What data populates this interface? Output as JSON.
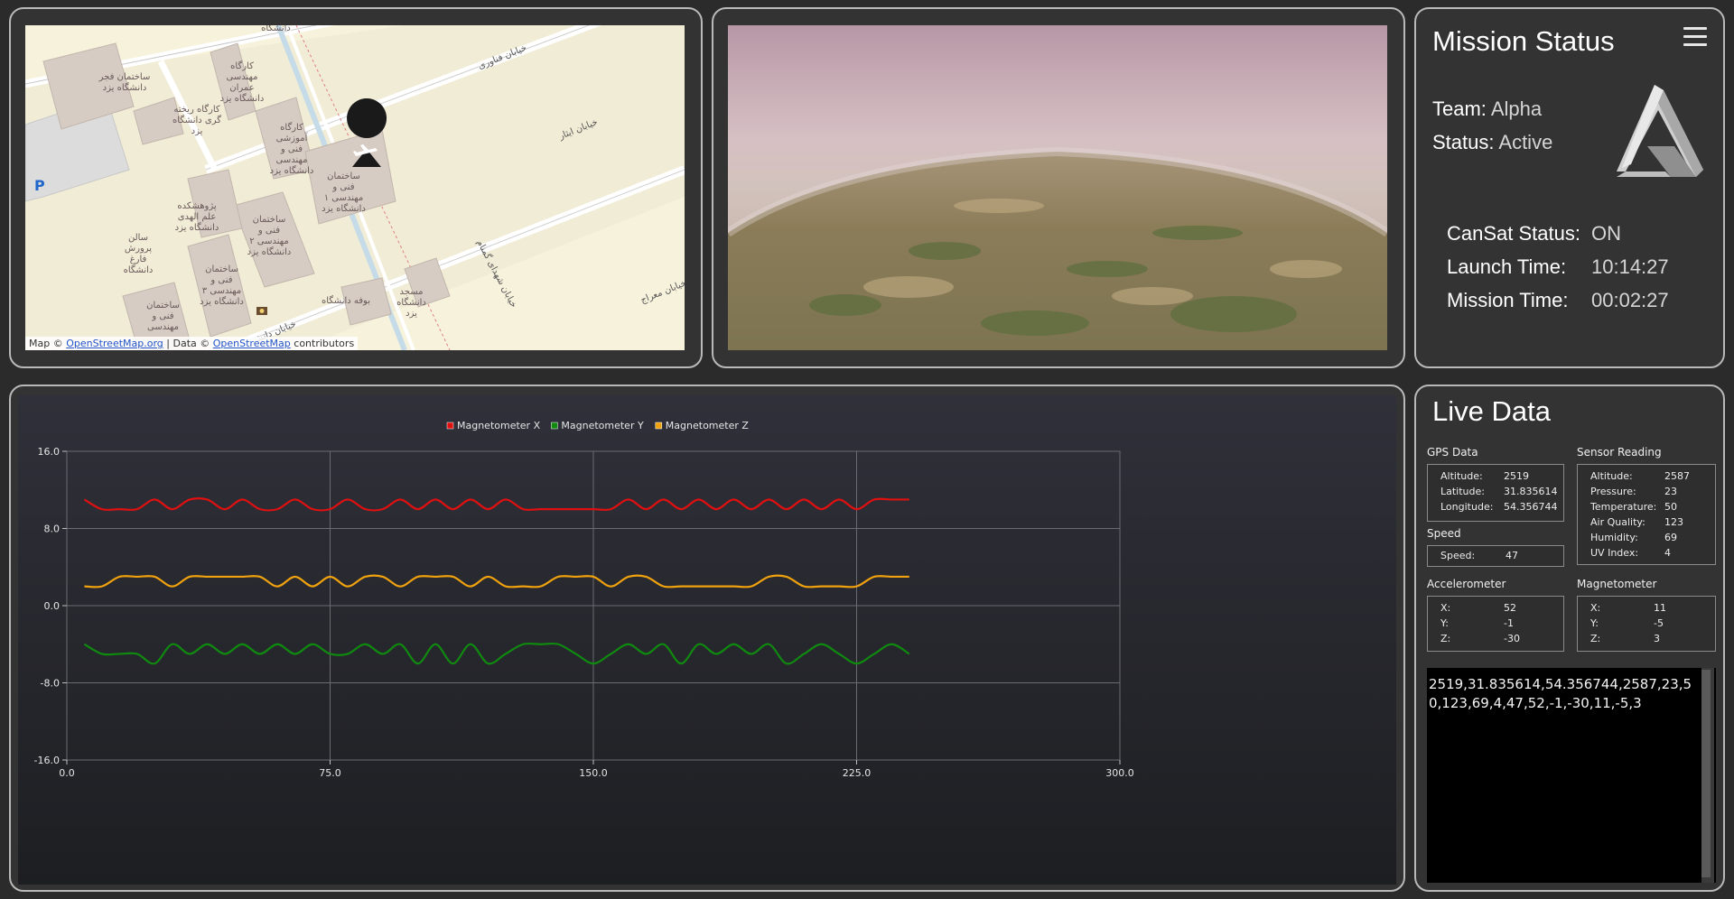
{
  "map": {
    "attribution_prefix": "Map © ",
    "attribution_link1": "OpenStreetMap.org",
    "attribution_mid": " | Data © ",
    "attribution_link2": "OpenStreetMap",
    "attribution_suffix": " contributors",
    "parking_label": "P",
    "buildings": [
      "ساختمان فجر دانشگاه یزد",
      "کارگاه مهندسی عمران دانشگاه یزد",
      "کارگاه ریخته گری دانشگاه یزد",
      "کارگاه آموزشی فنی و مهندسی دانشگاه یزد",
      "ساختمان فنی و مهندسی ۱ دانشگاه یزد",
      "پژوهشکده علم الهدی دانشگاه یزد",
      "ساختمان فنی و مهندسی ۲ دانشگاه یزد",
      "سالن پرورش فارغ دانشگاه",
      "ساختمان فنی و مهندسی ۳ دانشگاه یزد",
      "ساختمان فنی و مهندسی",
      "بوفه دانشگاه",
      "مسجد دانشگاه یزد",
      "دانشگاه"
    ],
    "streets": [
      "خیابان فناوری",
      "خیابان ایثار",
      "خیابان شهدای گمنام",
      "خیابان معراج",
      "خیابان دانش"
    ]
  },
  "status": {
    "title": "Mission Status",
    "team_label": "Team:",
    "team_value": "Alpha",
    "status_label": "Status:",
    "status_value": "Active",
    "cansat_label": "CanSat Status:",
    "cansat_value": "ON",
    "launch_label": "Launch Time:",
    "launch_value": "10:14:27",
    "mission_label": "Mission Time:",
    "mission_value": "00:02:27",
    "icons": {
      "menu": "menu-icon",
      "logo": "triangle-logo"
    }
  },
  "live": {
    "title": "Live Data",
    "gps": {
      "title": "GPS Data",
      "rows": [
        [
          "Altitude:",
          "2519"
        ],
        [
          "Latitude:",
          "31.835614"
        ],
        [
          "Longitude:",
          "54.356744"
        ]
      ]
    },
    "sensor": {
      "title": "Sensor Reading",
      "rows": [
        [
          "Altitude:",
          "2587"
        ],
        [
          "Pressure:",
          "23"
        ],
        [
          "Temperature:",
          "50"
        ],
        [
          "Air Quality:",
          "123"
        ],
        [
          "Humidity:",
          "69"
        ],
        [
          "UV Index:",
          "4"
        ]
      ]
    },
    "speed": {
      "title": "Speed",
      "rows": [
        [
          "Speed:",
          "47"
        ]
      ]
    },
    "accel": {
      "title": "Accelerometer",
      "rows": [
        [
          "X:",
          "52"
        ],
        [
          "Y:",
          "-1"
        ],
        [
          "Z:",
          "-30"
        ]
      ]
    },
    "mag": {
      "title": "Magnetometer",
      "rows": [
        [
          "X:",
          "11"
        ],
        [
          "Y:",
          "-5"
        ],
        [
          "Z:",
          "3"
        ]
      ]
    },
    "raw": "2519,31.835614,54.356744,2587,23,50,123,69,4,47,52,-1,-30,11,-5,3"
  },
  "chart_data": {
    "type": "line",
    "title": "",
    "xlabel": "",
    "ylabel": "",
    "xlim": [
      0,
      300
    ],
    "ylim": [
      -16,
      16
    ],
    "x_ticks": [
      "0.0",
      "75.0",
      "150.0",
      "225.0",
      "300.0"
    ],
    "y_ticks": [
      "16.0",
      "8.0",
      "0.0",
      "-8.0",
      "-16.0"
    ],
    "grid": true,
    "legend_position": "top-center",
    "x": [
      5,
      10,
      15,
      20,
      25,
      30,
      35,
      40,
      45,
      50,
      55,
      60,
      65,
      70,
      75,
      80,
      85,
      90,
      95,
      100,
      105,
      110,
      115,
      120,
      125,
      130,
      135,
      140,
      145,
      150,
      155,
      160,
      165,
      170,
      175,
      180,
      185,
      190,
      195,
      200,
      205,
      210,
      215,
      220,
      225,
      230,
      235,
      240
    ],
    "series": [
      {
        "name": "Magnetometer X",
        "color": "#e11010",
        "values": [
          11,
          10,
          10,
          10,
          11,
          10,
          11,
          11,
          10,
          11,
          10,
          10,
          11,
          10,
          10,
          11,
          10,
          10,
          11,
          10,
          11,
          10,
          11,
          10,
          11,
          10,
          10,
          10,
          10,
          10,
          10,
          11,
          10,
          11,
          10,
          11,
          10,
          11,
          10,
          11,
          10,
          11,
          10,
          11,
          10,
          11,
          11,
          11
        ]
      },
      {
        "name": "Magnetometer Y",
        "color": "#0f8a0f",
        "values": [
          -4,
          -5,
          -5,
          -5,
          -6,
          -4,
          -5,
          -4,
          -5,
          -4,
          -5,
          -4,
          -5,
          -4,
          -5,
          -5,
          -4,
          -5,
          -4,
          -6,
          -4,
          -6,
          -4,
          -6,
          -5,
          -4,
          -4,
          -4,
          -5,
          -6,
          -5,
          -4,
          -5,
          -4,
          -6,
          -4,
          -5,
          -4,
          -5,
          -4,
          -6,
          -5,
          -4,
          -5,
          -6,
          -5,
          -4,
          -5
        ]
      },
      {
        "name": "Magnetometer Z",
        "color": "#f0a20e",
        "values": [
          2,
          2,
          3,
          3,
          3,
          2,
          3,
          3,
          3,
          3,
          3,
          2,
          3,
          2,
          3,
          2,
          3,
          3,
          2,
          3,
          3,
          3,
          2,
          3,
          2,
          2,
          2,
          3,
          3,
          3,
          2,
          3,
          3,
          2,
          2,
          2,
          2,
          2,
          2,
          3,
          3,
          2,
          2,
          2,
          2,
          3,
          3,
          3
        ]
      }
    ]
  }
}
